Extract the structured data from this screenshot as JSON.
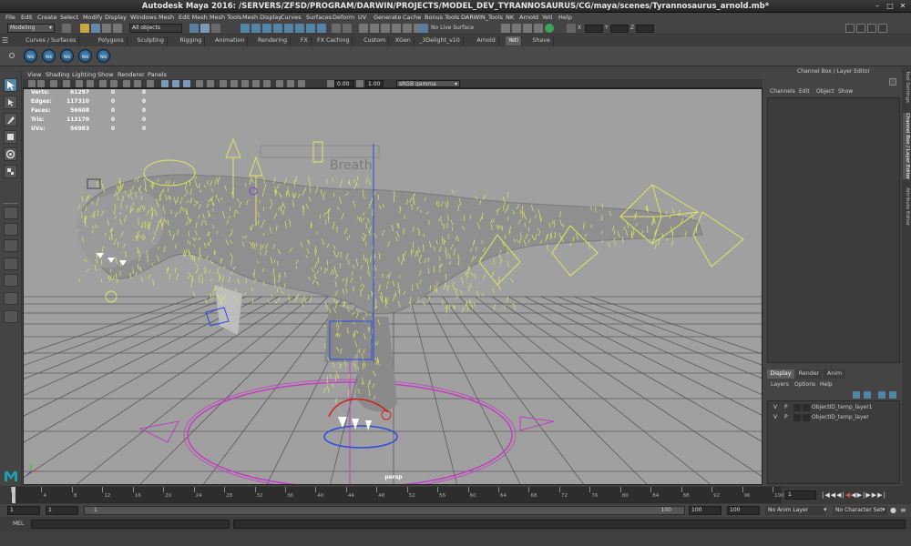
{
  "window": {
    "title": "Autodesk Maya 2016: /SERVERS/ZFSD/PROGRAM/DARWIN/PROJECTS/MODEL_DEV_TYRANNOSAURUS/CG/maya/scenes/Tyrannosaurus_arnold.mb*"
  },
  "menubar": [
    "File",
    "Edit",
    "Create",
    "Select",
    "Modify",
    "Display",
    "Windows",
    "Mesh",
    "Edit Mesh",
    "Mesh Tools",
    "Mesh Display",
    "Curves",
    "Surfaces",
    "Deform",
    "UV",
    "Generate",
    "Cache",
    "Bonus Tools",
    "DARWIN_Tools",
    "NK",
    "Arnold",
    "Yeti",
    "Help"
  ],
  "statusline": {
    "menuset": "Modeling",
    "selection_mode": "All objects",
    "live_surface": "No Live Surface",
    "x_label": "X",
    "y_label": "Y",
    "z_label": "Z"
  },
  "shelf_tabs": [
    "Curves / Surfaces",
    "Polygons",
    "Sculpting",
    "Rigging",
    "Animation",
    "Rendering",
    "FX",
    "FX Caching",
    "Custom",
    "XGen",
    "_3Delight_v10",
    "Arnold",
    "Yeti",
    "Shave"
  ],
  "shelf_active": "Yeti",
  "shelf_icons": [
    "Yeti",
    "Yeti",
    "Yeti",
    "Yeti",
    "Yeti"
  ],
  "viewport": {
    "menu": [
      "View",
      "Shading",
      "Lighting",
      "Show",
      "Renderer",
      "Panels"
    ],
    "exposure": "0.00",
    "gamma": "1.00",
    "color_space": "sRGB gamma",
    "camera_label": "persp",
    "annotation": "Breath",
    "hud": [
      {
        "label": "Verts:",
        "v1": "61297",
        "v2": "0",
        "v3": "0"
      },
      {
        "label": "Edges:",
        "v1": "117310",
        "v2": "0",
        "v3": "0"
      },
      {
        "label": "Faces:",
        "v1": "56608",
        "v2": "0",
        "v3": "0"
      },
      {
        "label": "Tris:",
        "v1": "113170",
        "v2": "0",
        "v3": "0"
      },
      {
        "label": "UVs:",
        "v1": "56983",
        "v2": "0",
        "v3": "0"
      }
    ]
  },
  "channel_box": {
    "title": "Channel Box / Layer Editor",
    "menu": [
      "Channels",
      "Edit",
      "Object",
      "Show"
    ]
  },
  "right_tabs": [
    "Tool Settings",
    "Channel Box / Layer Editor",
    "Attribute Editor"
  ],
  "layer_editor": {
    "tabs": [
      "Display",
      "Render",
      "Anim"
    ],
    "active_tab": "Display",
    "menu": [
      "Layers",
      "Options",
      "Help"
    ],
    "layers": [
      {
        "v": "V",
        "p": "P",
        "name": "ObjectID_temp_layer1"
      },
      {
        "v": "V",
        "p": "P",
        "name": "ObjectID_temp_layer"
      }
    ]
  },
  "timeline": {
    "ticks": [
      "1",
      "4",
      "8",
      "12",
      "16",
      "20",
      "24",
      "28",
      "32",
      "36",
      "40",
      "44",
      "48",
      "52",
      "56",
      "60",
      "64",
      "68",
      "72",
      "76",
      "80",
      "84",
      "88",
      "92",
      "96",
      "100"
    ],
    "current_frame": "1"
  },
  "range": {
    "start": "1",
    "start_inner": "1",
    "slider_start": "1",
    "slider_end": "100",
    "end_inner": "100",
    "end": "100",
    "anim_layer": "No Anim Layer",
    "character_set": "No Character Set"
  },
  "command_line": {
    "label": "MEL"
  },
  "colors": {
    "viewport_bg": "#a0a0a0",
    "accent": "#5285a6",
    "fur": "#e0e65c",
    "grid": "#585858",
    "manipulator": "#c040c0"
  }
}
